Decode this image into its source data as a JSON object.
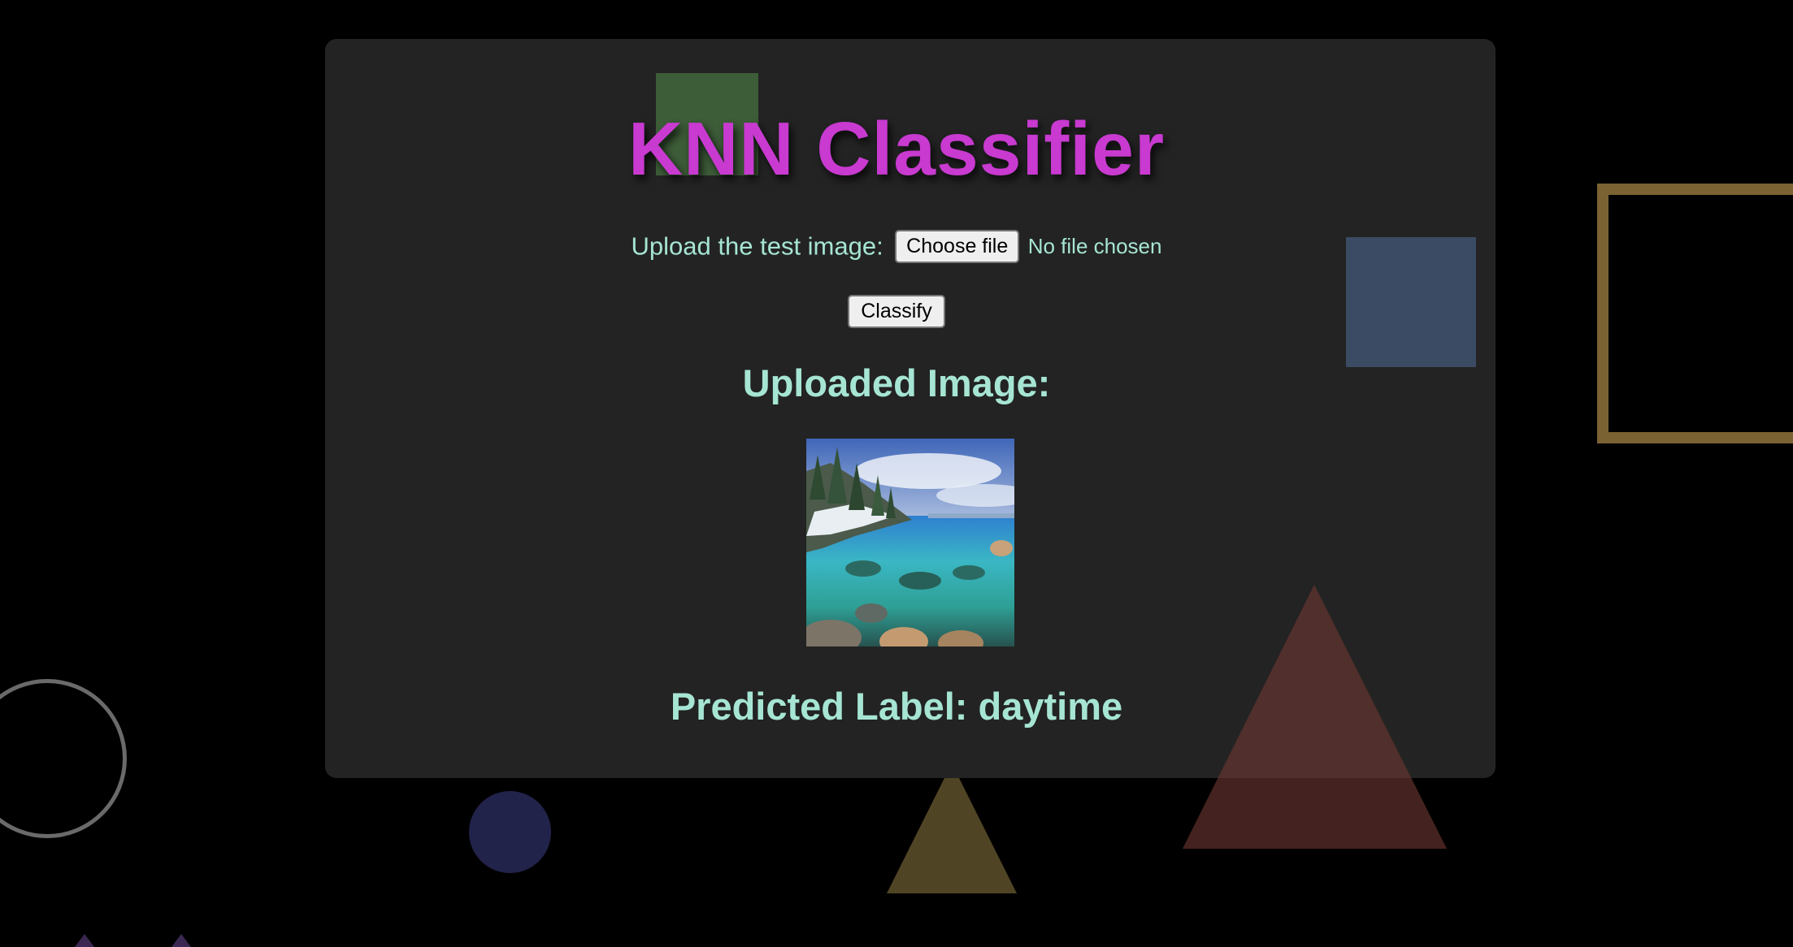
{
  "app": {
    "title": "KNN Classifier"
  },
  "upload": {
    "label": "Upload the test image:",
    "choose_file_label": "Choose file",
    "file_status": "No file chosen"
  },
  "actions": {
    "classify_label": "Classify"
  },
  "result": {
    "uploaded_heading": "Uploaded Image:",
    "uploaded_image_icon": "lake-landscape-photo",
    "predicted_prefix": "Predicted Label:",
    "predicted_value": "daytime"
  },
  "colors": {
    "background": "#000000",
    "card": "#232323",
    "title": "#c83ad0",
    "text": "#a6e5d3"
  }
}
